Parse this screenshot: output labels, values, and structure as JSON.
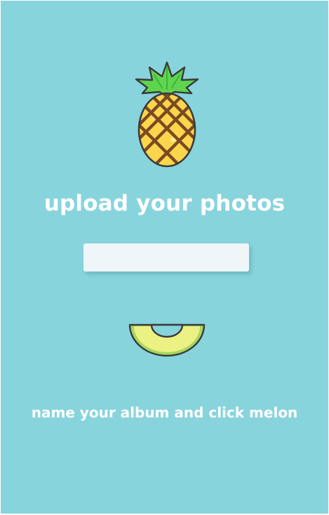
{
  "page": {
    "title": "upload your photos",
    "instructions": "name your album and click melon"
  },
  "album_input": {
    "value": "",
    "placeholder": ""
  },
  "icons": {
    "logo": "pineapple-icon",
    "submit": "melon-icon"
  },
  "colors": {
    "background": "#88d4dc",
    "text": "#ffffff",
    "input_background": "#eef6fa",
    "pineapple_body": "#fbd54b",
    "pineapple_leaves": "#5fd44f",
    "melon_flesh": "#ecf184",
    "melon_rind": "#a7d660"
  }
}
